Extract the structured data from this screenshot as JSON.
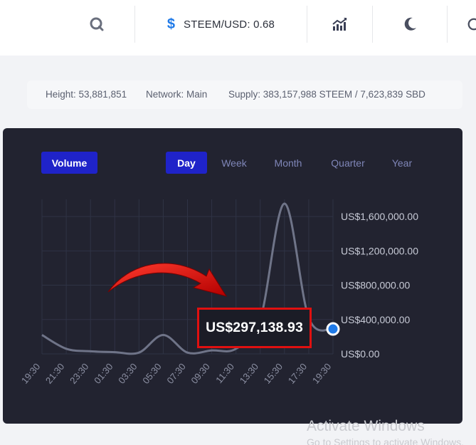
{
  "header": {
    "search_icon": "search-icon",
    "price_label": "STEEM/USD: 0.68",
    "chart_icon": "chart-trend-icon",
    "theme_icon": "moon-icon"
  },
  "info": {
    "height": "Height: 53,881,851",
    "network": "Network: Main",
    "supply": "Supply: 383,157,988 STEEM / 7,623,839 SBD"
  },
  "panel": {
    "metric_button": "Volume",
    "ranges": [
      "Day",
      "Week",
      "Month",
      "Quarter",
      "Year"
    ],
    "active_range": "Day"
  },
  "chart_data": {
    "type": "line",
    "x": [
      "19:30",
      "21:30",
      "23:30",
      "01:30",
      "03:30",
      "05:30",
      "07:30",
      "09:30",
      "11:30",
      "13:30",
      "15:30",
      "17:30",
      "19:30"
    ],
    "y_ticks": [
      "US$0.00",
      "US$400,000.00",
      "US$800,000.00",
      "US$1,200,000.00",
      "US$1,600,000.00"
    ],
    "ylim": [
      0,
      1800000
    ],
    "series": [
      {
        "values": [
          220000,
          60000,
          30000,
          20000,
          15000,
          220000,
          15000,
          40000,
          60000,
          400000,
          1750000,
          420000,
          290000
        ]
      }
    ],
    "highlight_value": "US$297,138.93",
    "colors": {
      "line": "#6f7488",
      "point": "#1f7ae8",
      "grid": "#2f3345"
    }
  },
  "watermark": {
    "line1": "Activate Windows",
    "line2": "Go to Settings to activate Windows."
  }
}
